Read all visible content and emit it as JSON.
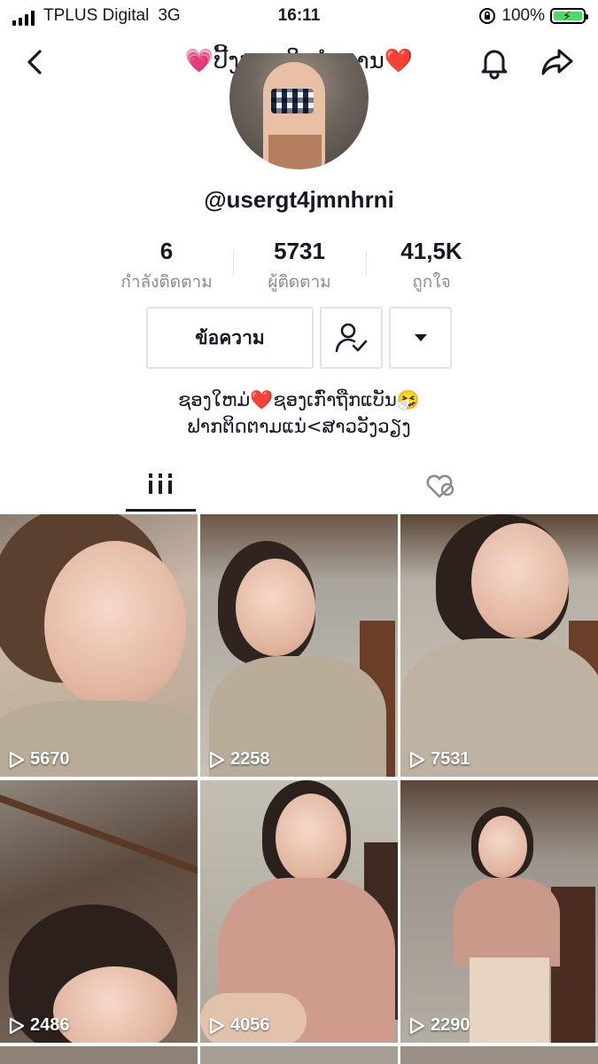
{
  "status_bar": {
    "carrier": "TPLUS Digital",
    "network": "3G",
    "time": "16:11",
    "battery": "100%"
  },
  "header": {
    "title": "💗ປີ້ງຫມາໃນຕຳນານ❤️"
  },
  "profile": {
    "username": "@usergt4jmnhrni",
    "stats": [
      {
        "value": "6",
        "label": "กำลังติดตาม"
      },
      {
        "value": "5731",
        "label": "ผู้ติดตาม"
      },
      {
        "value": "41,5K",
        "label": "ถูกใจ"
      }
    ],
    "message_button": "ข้อความ",
    "bio_line1": "ຊອງໃຫມ່❤️ຊອງເກົ່າຖືກແບັນ🤧",
    "bio_line2": "ຟາກຕິດຕາມແນ່<ສາວວັງວຽງ"
  },
  "tabs": [
    {
      "icon": "grid-icon",
      "active": true
    },
    {
      "icon": "heart-hidden-icon",
      "active": false
    }
  ],
  "videos": [
    {
      "views": "5670"
    },
    {
      "views": "2258"
    },
    {
      "views": "7531"
    },
    {
      "views": "2486"
    },
    {
      "views": "4056"
    },
    {
      "views": "2290"
    }
  ],
  "colors": {
    "text": "#161823",
    "secondary_text": "#8a8b91",
    "border": "#e3e3e4",
    "battery_green": "#4cd964"
  }
}
